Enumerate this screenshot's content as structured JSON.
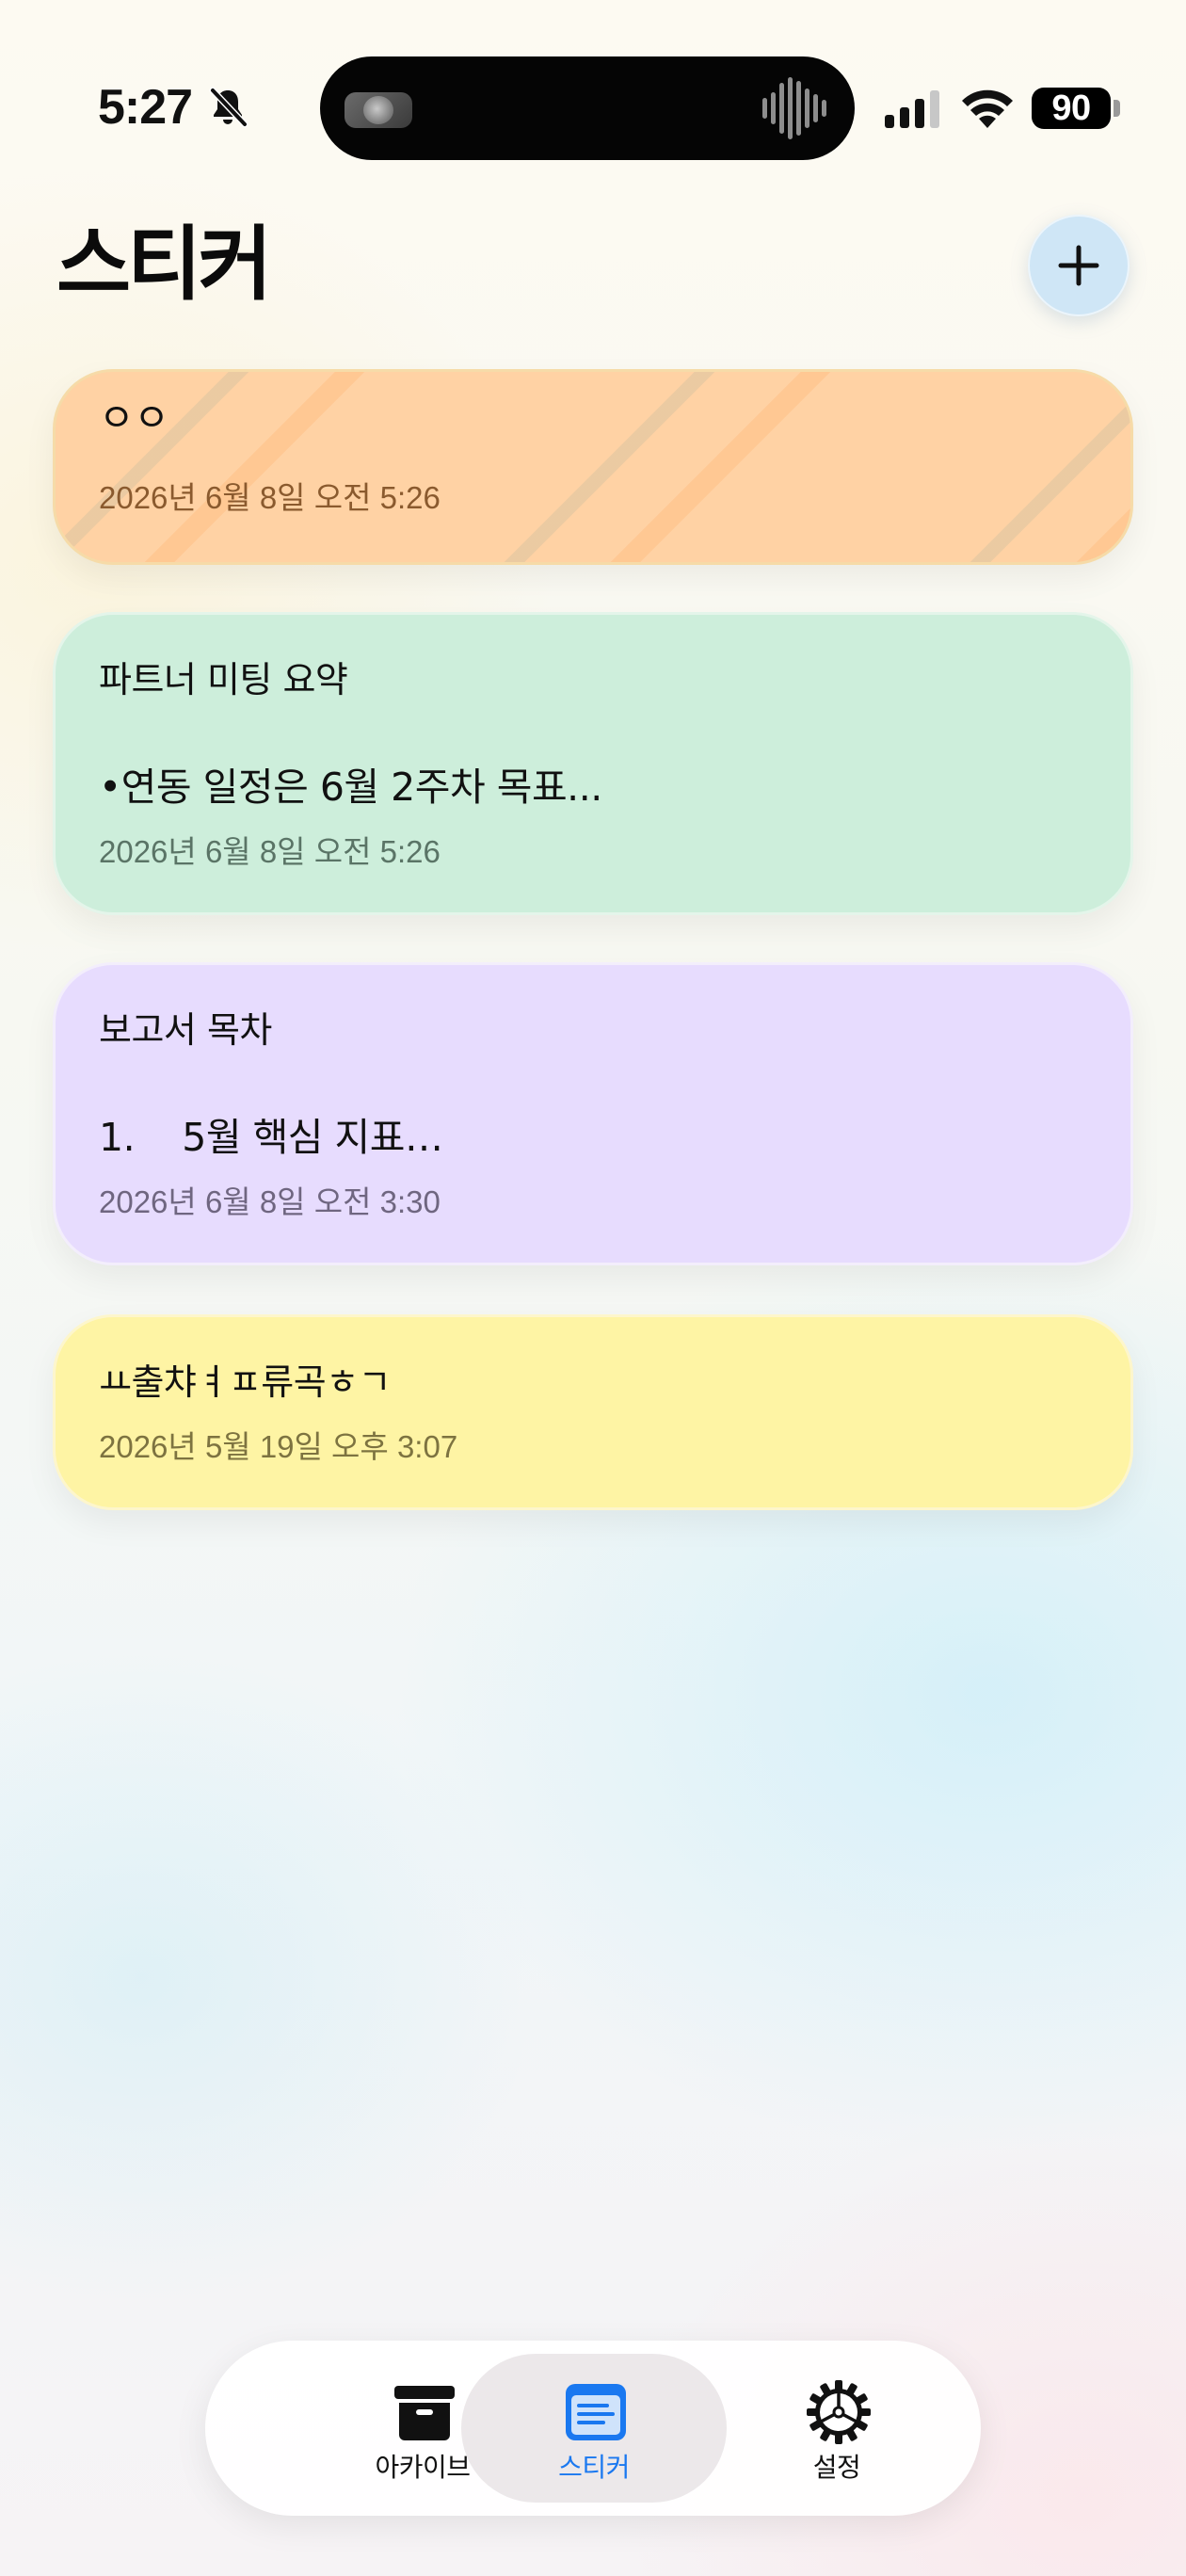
{
  "status_bar": {
    "time": "5:27",
    "battery": "90"
  },
  "header": {
    "title": "스티커"
  },
  "cards": [
    {
      "text": "ㅇㅇ",
      "date": "2026년 6월 8일 오전 5:26",
      "color": "#ffd2a4"
    },
    {
      "title": "파트너 미팅 요약",
      "text": "•연동 일정은 6월 2주차 목표...",
      "date": "2026년 6월 8일 오전 5:26",
      "color": "#cdeedb"
    },
    {
      "title": "보고서 목차",
      "text": "1.    5월 핵심 지표…",
      "date": "2026년 6월 8일 오전 3:30",
      "color": "#e7dcfe"
    },
    {
      "text": "ㅛ출챠ㅕㅍ류곡ㅎㄱ",
      "date": "2026년 5월 19일 오후 3:07",
      "color": "#fef4a4"
    }
  ],
  "tab_bar": {
    "tabs": [
      {
        "label": "아카이브",
        "icon": "archive-box-icon"
      },
      {
        "label": "스티커",
        "icon": "sticker-note-icon",
        "active": true
      },
      {
        "label": "설정",
        "icon": "gear-icon"
      }
    ],
    "accent": "#1a78f0"
  }
}
